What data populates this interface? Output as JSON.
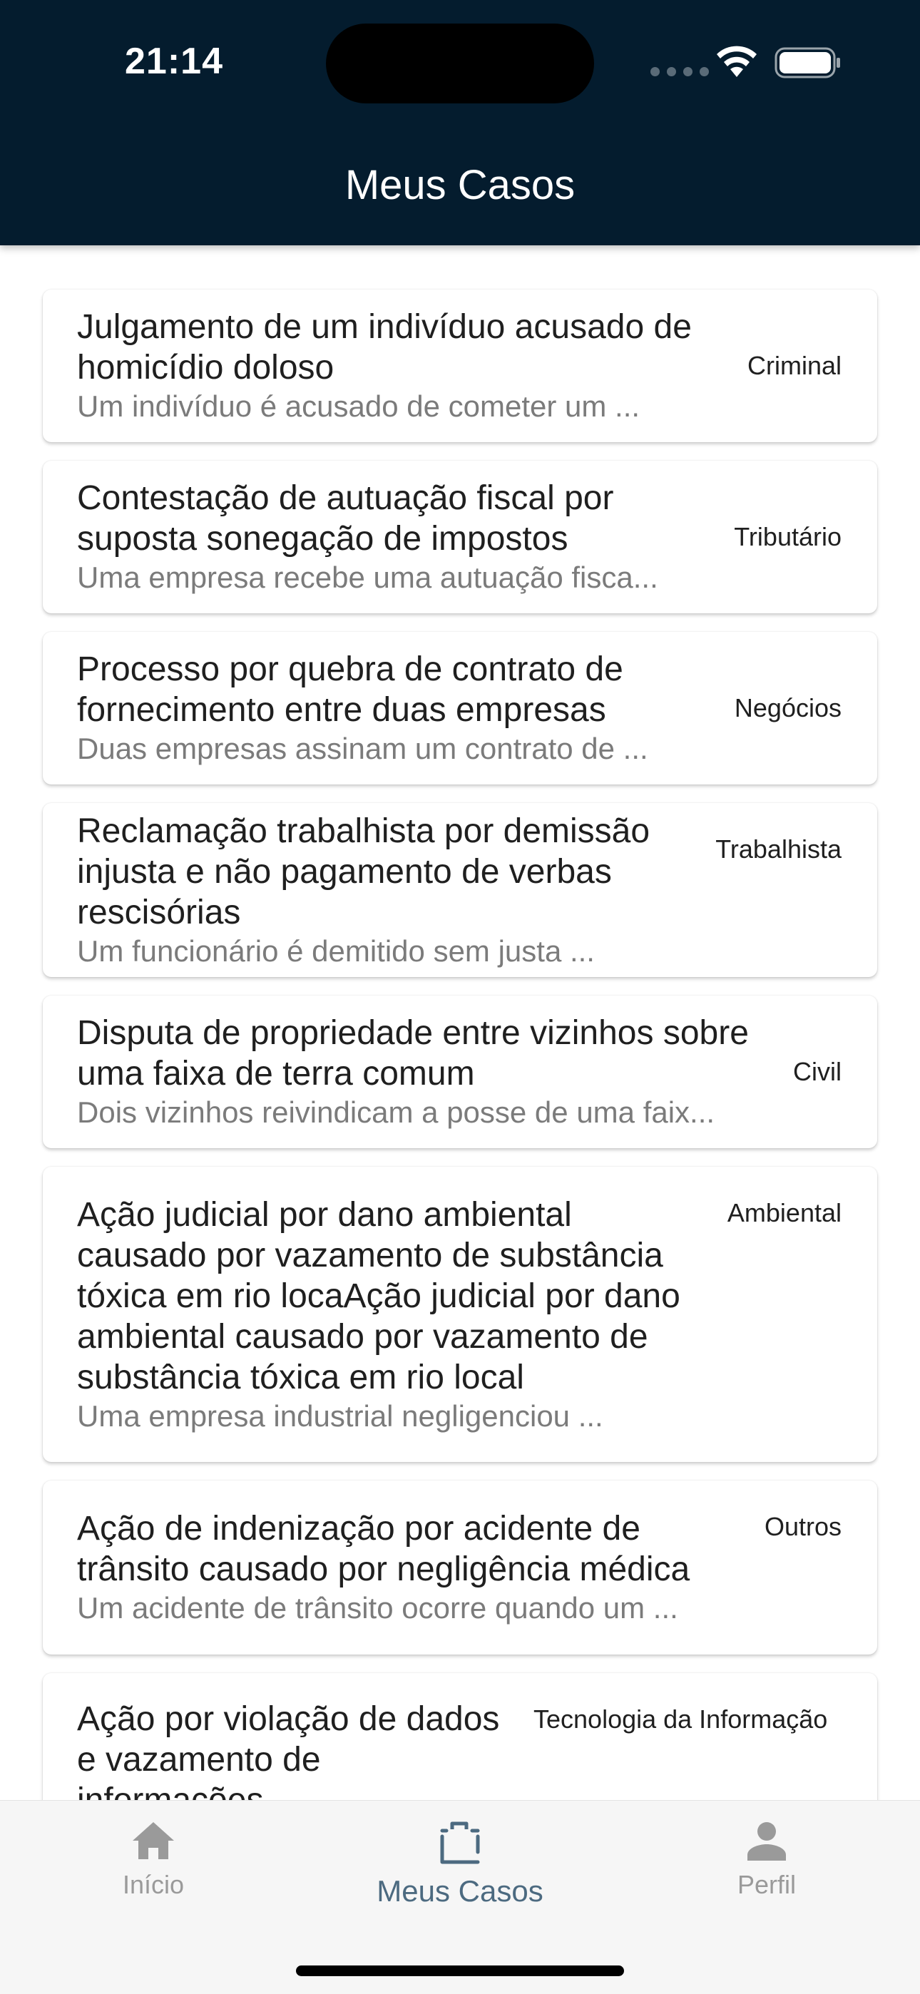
{
  "status_bar": {
    "time": "21:14"
  },
  "header": {
    "title": "Meus Casos"
  },
  "cases": [
    {
      "title": "Julgamento de um indivíduo acusado de homicídio doloso",
      "description": "Um indivíduo é acusado de cometer um ...",
      "category": "Criminal"
    },
    {
      "title": "Contestação de autuação fiscal por suposta sonegação de impostos",
      "description": "Uma empresa recebe uma autuação fisca...",
      "category": "Tributário"
    },
    {
      "title": "Processo por quebra de contrato de fornecimento entre duas empresas",
      "description": "Duas empresas assinam um contrato de ...",
      "category": "Negócios"
    },
    {
      "title": "Reclamação trabalhista por demissão injusta e não pagamento de verbas rescisórias",
      "description": "Um funcionário é demitido sem justa ...",
      "category": "Trabalhista"
    },
    {
      "title": "Disputa de propriedade entre vizinhos sobre uma faixa de terra comum",
      "description": "Dois vizinhos reivindicam a posse de uma faix...",
      "category": "Civil"
    },
    {
      "title": "Ação judicial por dano ambiental causado por vazamento de substância tóxica em rio locaAção judicial por dano ambiental causado por vazamento de substância tóxica em rio local",
      "description": "Uma empresa industrial negligenciou ...",
      "category": "Ambiental"
    },
    {
      "title": "Ação de indenização por acidente de trânsito causado por negligência médica",
      "description": "Um acidente de trânsito ocorre quando um ...",
      "category": "Outros"
    },
    {
      "title": "Ação por violação de dados e vazamento de informações",
      "description": "",
      "category": "Tecnologia da Informação"
    }
  ],
  "tabbar": {
    "home": {
      "label": "Início",
      "icon": "home-icon"
    },
    "cases": {
      "label": "Meus Casos",
      "icon": "briefcase-icon"
    },
    "profile": {
      "label": "Perfil",
      "icon": "person-icon"
    },
    "active": "cases",
    "active_color": "#4c6a80",
    "inactive_color": "#9a9a9a"
  },
  "colors": {
    "header_bg": "#041c2e"
  }
}
